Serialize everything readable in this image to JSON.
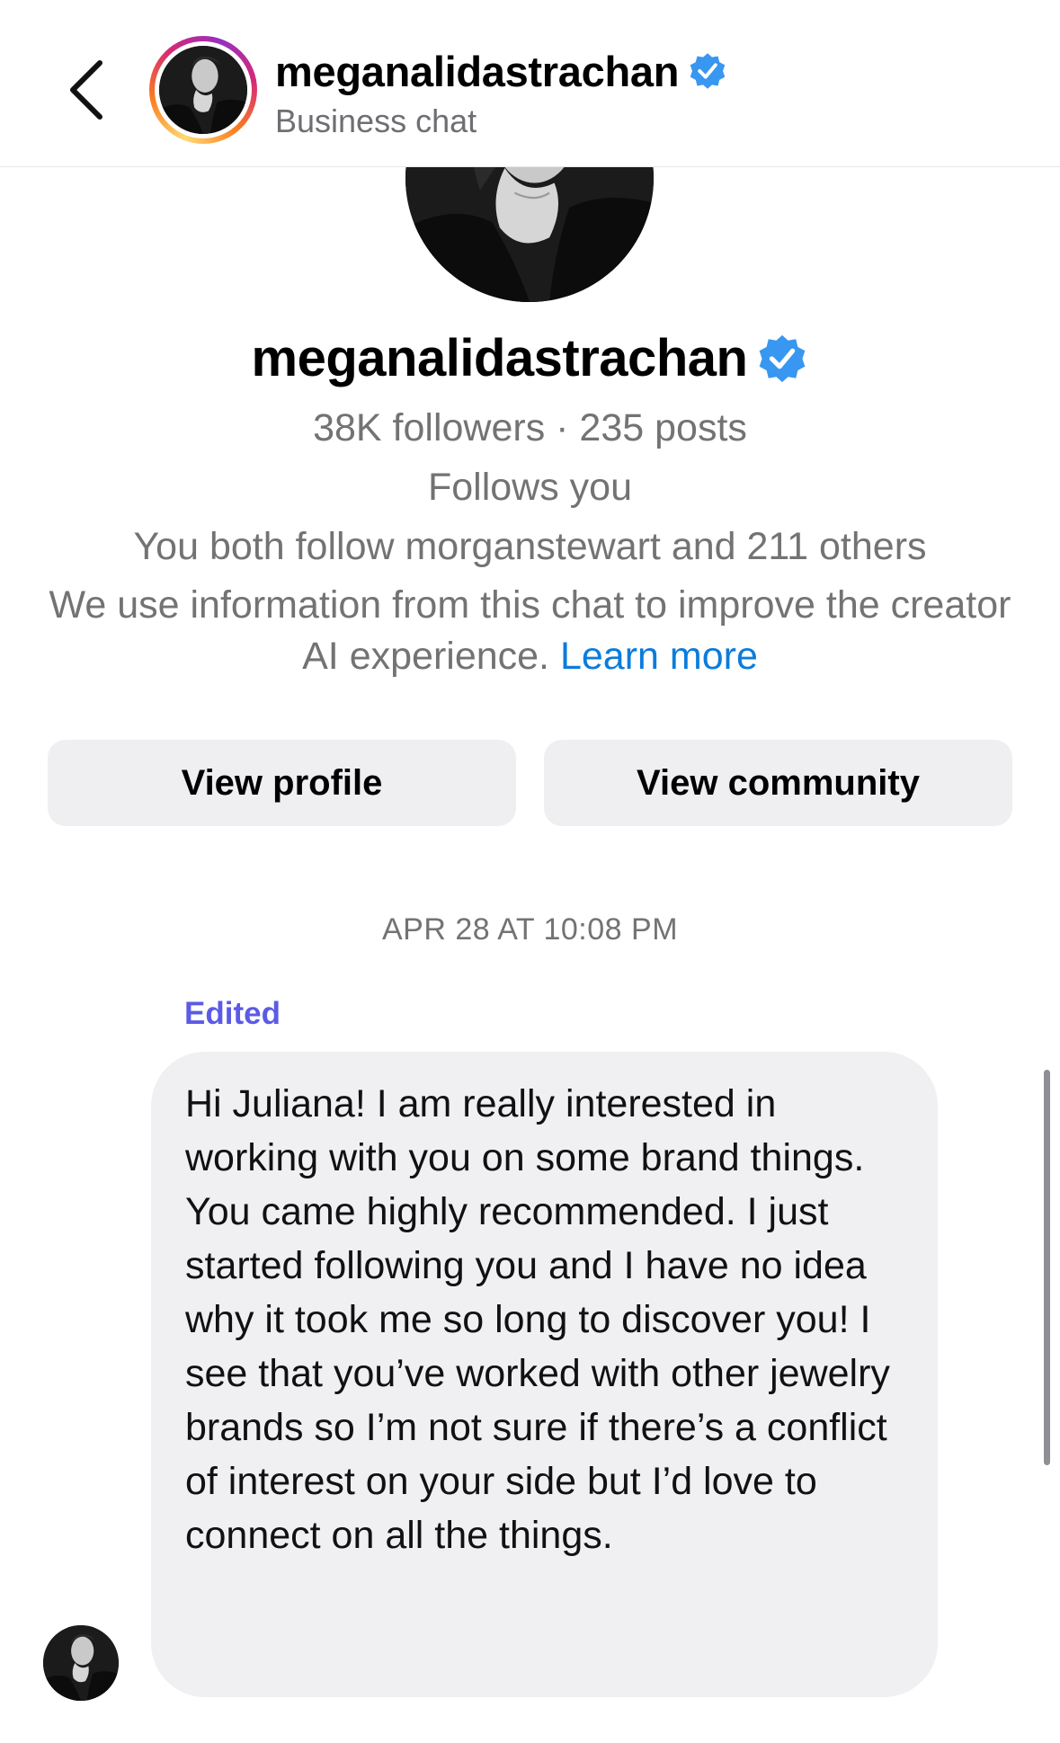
{
  "header": {
    "title": "meganalidastrachan",
    "subtitle": "Business chat",
    "back_icon": "chevron-left-icon",
    "verified_icon": "verified-badge-icon"
  },
  "profile": {
    "name": "meganalidastrachan",
    "stats": "38K followers · 235 posts",
    "follows_you": "Follows you",
    "mutuals": "You both follow morganstewart and 211 others",
    "info": "We use information from this chat to improve the creator AI experience.",
    "learn_more": "Learn more"
  },
  "buttons": {
    "view_profile": "View profile",
    "view_community": "View community"
  },
  "chat": {
    "timestamp": "APR 28 AT 10:08 PM",
    "edited_label": "Edited",
    "message": "Hi Juliana! I am really interested in working with you on some brand things. You came highly recommended. I just started following you and I have no idea why it took me so long to discover you! I see that you’ve worked with other jewelry brands so I’m not sure if there’s a conflict of interest on your side but I’d love to connect on all the things."
  },
  "colors": {
    "verified_blue": "#3897f0",
    "link_blue": "#0a7cdc",
    "edited_purple": "#5b5be6",
    "bubble_bg": "#f0f0f3",
    "button_bg": "#efeff2"
  }
}
